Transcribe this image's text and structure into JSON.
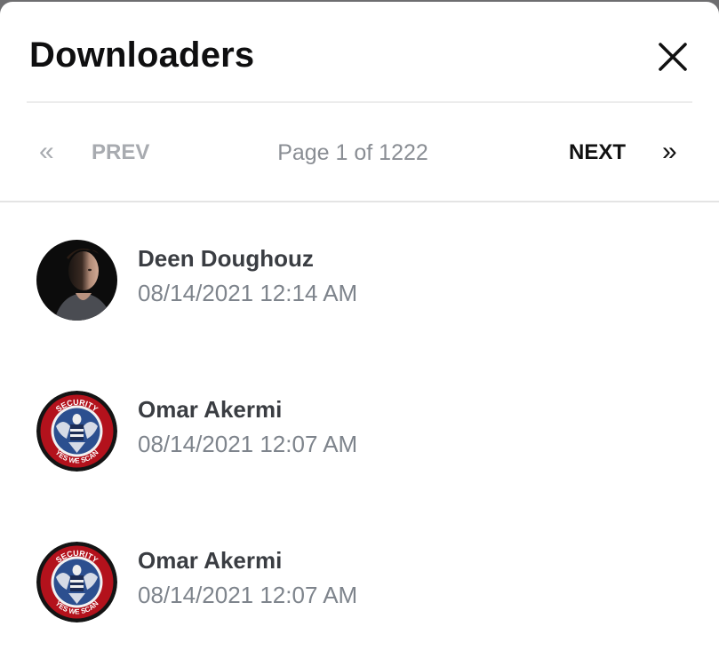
{
  "modal": {
    "title": "Downloaders"
  },
  "icons": {
    "close": "close-icon",
    "first_page": "double-chevron-left-icon",
    "last_page": "double-chevron-right-icon"
  },
  "pagination": {
    "first_glyph": "«",
    "prev_label": "PREV",
    "page_info": "Page 1 of 1222",
    "next_label": "NEXT",
    "last_glyph": "»",
    "current_page": 1,
    "total_pages": 1222
  },
  "downloaders": [
    {
      "name": "Deen Doughouz",
      "datetime": "08/14/2021 12:14 AM",
      "avatar": "portrait-photo"
    },
    {
      "name": "Omar Akermi",
      "datetime": "08/14/2021 12:07 AM",
      "avatar": "security-agency-emblem"
    },
    {
      "name": "Omar Akermi",
      "datetime": "08/14/2021 12:07 AM",
      "avatar": "security-agency-emblem"
    }
  ],
  "emblem_text": {
    "top": "SECURITY",
    "left": "NATIONAL",
    "right": "AGENCY",
    "bottom": "YES WE SCAN"
  },
  "colors": {
    "title": "#0f0f10",
    "disabled_nav": "#a8abb0",
    "active_nav": "#111111",
    "name_text": "#3a3d42",
    "date_text": "#7e848c",
    "emblem_ring": "#b3121c",
    "emblem_blue": "#2c4f8f"
  }
}
